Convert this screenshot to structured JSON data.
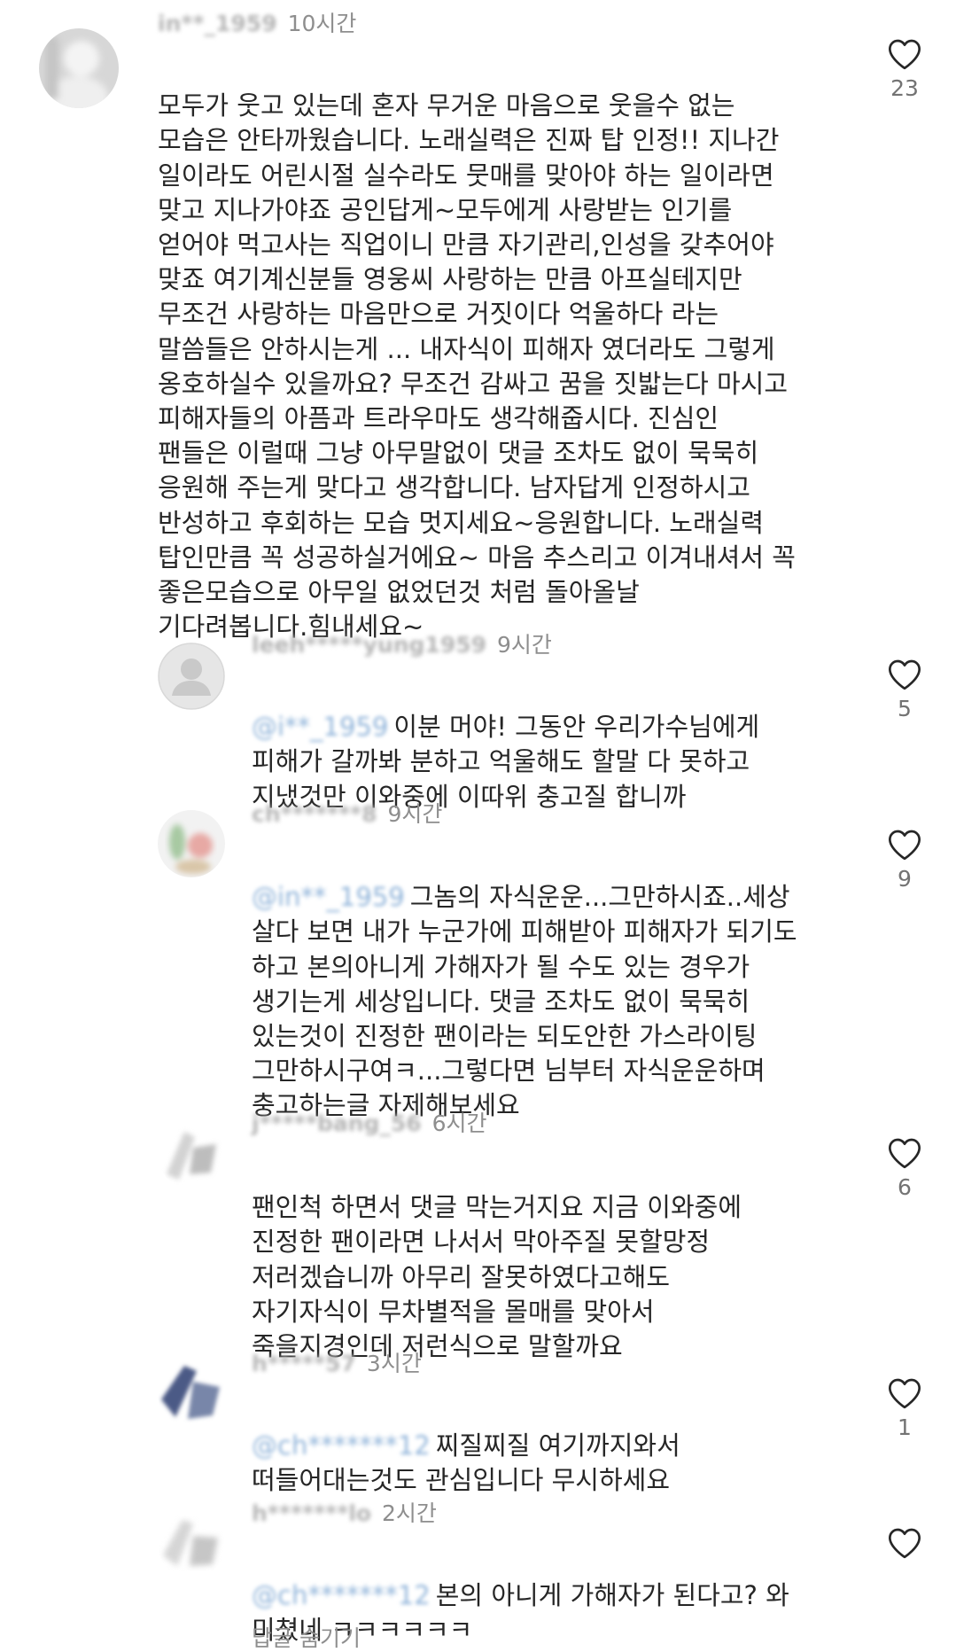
{
  "comments": [
    {
      "username": "in**_1959",
      "time": "10시간",
      "mention": "",
      "text": "모두가 웃고 있는데 혼자 무거운 마음으로 웃을수 없는\n모습은 안타까웠습니다. 노래실력은 진짜 탑 인정!! 지나간\n일이라도 어린시절 실수라도 뭇매를 맞아야 하는 일이라면\n맞고 지나가야죠 공인답게~모두에게 사랑받는 인기를\n얻어야 먹고사는 직업이니 만큼 자기관리,인성을 갖추어야\n맞죠 여기계신분들 영웅씨 사랑하는 만큼 아프실테지만\n무조건 사랑하는 마음만으로 거짓이다 억울하다 라는\n말씀들은 안하시는게 ... 내자식이 피해자 였더라도 그렇게\n옹호하실수 있을까요? 무조건 감싸고 꿈을 짓밟는다 마시고\n피해자들의 아픔과 트라우마도 생각해줍시다. 진심인\n팬들은 이럴때 그냥 아무말없이 댓글 조차도 없이 묵묵히\n응원해 주는게 맞다고 생각합니다. 남자답게 인정하시고\n반성하고 후회하는 모습 멋지세요~응원합니다. 노래실력\n탑인만큼 꼭 성공하실거에요~ 마음 추스리고 이겨내셔서 꼭\n좋은모습으로 아무일 없었던것 처럼 돌아올날\n기다려봅니다.힘내세요~",
      "likes": "23",
      "avatar": "blurred-photo"
    },
    {
      "username": "leeh*****yung1959",
      "time": "9시간",
      "mention": "@i**_1959",
      "text": "이분 머야! 그동안 우리가수님에게\n피해가 갈까봐 분하고 억울해도 할말 다 못하고\n지냈것만 이와중에 이따위 충고질 합니까",
      "likes": "5",
      "avatar": "default-person"
    },
    {
      "username": "ch*******8",
      "time": "9시간",
      "mention": "@in**_1959",
      "text": "그놈의 자식운운...그만하시죠..세상\n살다 보면 내가 누군가에 피해받아 피해자가 되기도\n하고 본의아니게 가해자가 될 수도 있는 경우가\n생기는게 세상입니다. 댓글 조차도 없이 묵묵히\n있는것이 진정한 팬이라는 되도안한 가스라이팅\n그만하시구여ㅋ...그렇다면 님부터 자식운운하며\n충고하는글 자제해보세요",
      "likes": "9",
      "avatar": "blurred-photo"
    },
    {
      "username": "j*****bang_56",
      "time": "6시간",
      "mention": "",
      "text": "팬인척 하면서 댓글 막는거지요 지금 이와중에\n진정한 팬이라면 나서서 막아주질 못할망정\n저러겠습니까 아무리 잘못하였다고해도\n자기자식이 무차별적을 몰매를 맞아서\n죽을지경인데 저런식으로 말할까요",
      "likes": "6",
      "avatar": "blurred-photo"
    },
    {
      "username": "h*****57",
      "time": "3시간",
      "mention": "@ch*******12",
      "text": "찌질찌질 여기까지와서\n떠들어대는것도 관심입니다 무시하세요",
      "likes": "1",
      "avatar": "blurred-dark"
    },
    {
      "username": "h*******lo",
      "time": "2시간",
      "mention": "@ch*******12",
      "text": "본의 아니게 가해자가 된다고? 와\n미쳤네 ㅋㅋㅋㅋㅋㅋ",
      "likes": "",
      "avatar": "blurred-photo"
    }
  ],
  "more_replies": "답글 숨기기",
  "icons": {
    "like": "heart-outline-icon"
  },
  "colors": {
    "text": "#262626",
    "secondary": "#8e8e8e",
    "heart_stroke": "#262626"
  }
}
